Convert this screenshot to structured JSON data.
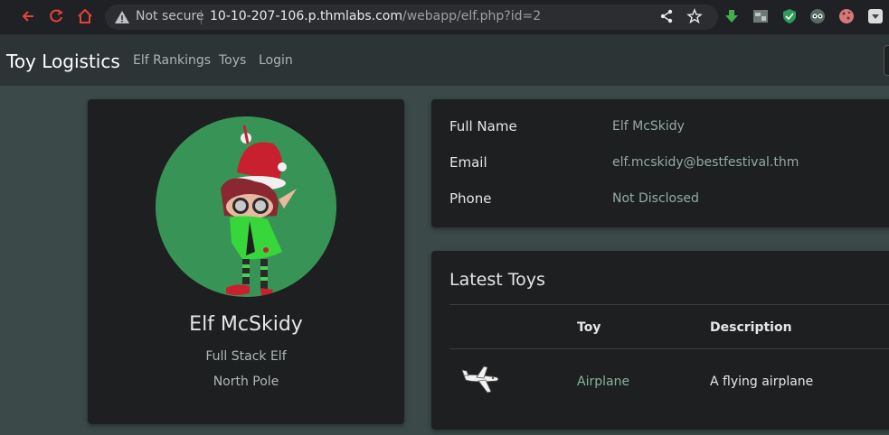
{
  "browser": {
    "security_label": "Not secure",
    "url_host": "10-10-207-106.p.thmlabs.com",
    "url_path": "/webapp/elf.php?id=2",
    "icons": [
      "back-icon",
      "reload-icon",
      "home-icon",
      "warning-icon",
      "share-icon",
      "star-icon",
      "download-extension-icon",
      "extension-icon",
      "shield-extension-icon",
      "spy-extension-icon",
      "cookie-extension-icon",
      "menu-extension-icon"
    ]
  },
  "navbar": {
    "brand": "Toy Logistics",
    "links": [
      "Elf Rankings",
      "Toys",
      "Login"
    ]
  },
  "profile": {
    "name": "Elf McSkidy",
    "role": "Full Stack Elf",
    "location": "North Pole",
    "avatar": "elf-avatar"
  },
  "details": {
    "rows": [
      {
        "label": "Full Name",
        "value": "Elf McSkidy"
      },
      {
        "label": "Email",
        "value": "elf.mcskidy@bestfestival.thm"
      },
      {
        "label": "Phone",
        "value": "Not Disclosed"
      }
    ]
  },
  "latest_toys": {
    "title": "Latest Toys",
    "columns": [
      "",
      "Toy",
      "Description"
    ],
    "rows": [
      {
        "image": "airplane-icon",
        "toy": "Airplane",
        "description": "A flying airplane"
      }
    ]
  },
  "colors": {
    "page_bg": "#3b4948",
    "navbar_bg": "#2d3436",
    "card_bg": "#1d1f21",
    "avatar_bg": "#389456",
    "link_green": "#86b39c"
  }
}
